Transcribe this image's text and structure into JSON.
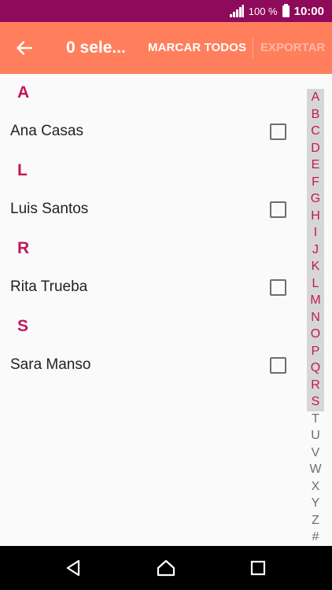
{
  "status_bar": {
    "battery": "100 %",
    "time": "10:00"
  },
  "toolbar": {
    "title": "0 sele...",
    "mark_all_label": "MARCAR TODOS",
    "export_label": "EXPORTAR"
  },
  "sections": [
    {
      "letter": "A",
      "contacts": [
        {
          "name": "Ana Casas",
          "checked": false
        }
      ]
    },
    {
      "letter": "L",
      "contacts": [
        {
          "name": "Luis Santos",
          "checked": false
        }
      ]
    },
    {
      "letter": "R",
      "contacts": [
        {
          "name": "Rita Trueba",
          "checked": false
        }
      ]
    },
    {
      "letter": "S",
      "contacts": [
        {
          "name": "Sara Manso",
          "checked": false
        }
      ]
    }
  ],
  "index_letters": [
    "A",
    "B",
    "C",
    "D",
    "E",
    "F",
    "G",
    "H",
    "I",
    "J",
    "K",
    "L",
    "M",
    "N",
    "O",
    "P",
    "Q",
    "R",
    "S",
    "T",
    "U",
    "V",
    "W",
    "X",
    "Y",
    "Z",
    "#"
  ],
  "colors": {
    "status_bar": "#8e0a5a",
    "toolbar": "#ff7f5c",
    "accent": "#c2185b"
  }
}
